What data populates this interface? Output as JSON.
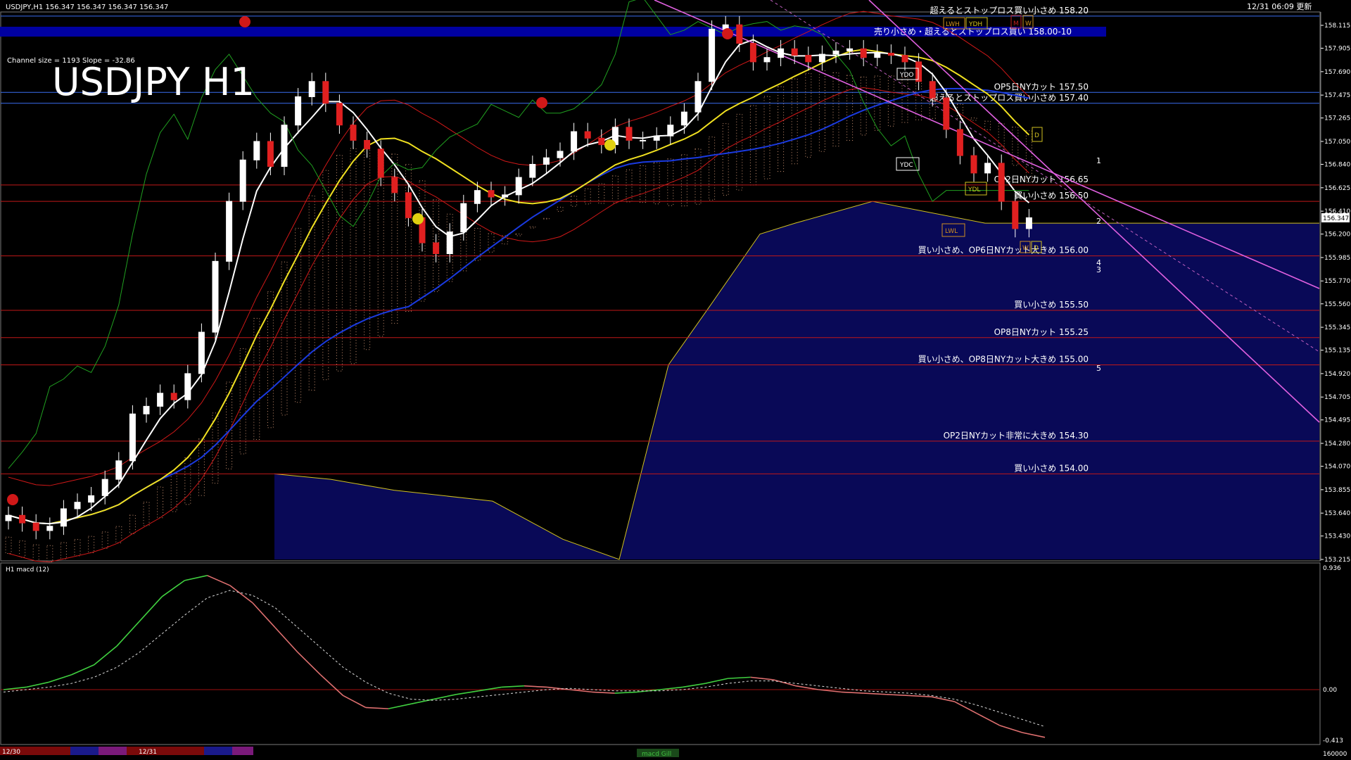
{
  "window": {
    "header": "USDJPY,H1  156.347 156.347 156.347 156.347",
    "updated": "12/31 06:09 更新",
    "big_title": "USDJPY H1",
    "channel_info": "Channel size = 1193 Slope = -32.86"
  },
  "chart_data": {
    "type": "candlestick",
    "price_range": [
      153.215,
      158.2
    ],
    "price_ticks": [
      "158.115",
      "157.905",
      "157.690",
      "157.475",
      "157.265",
      "157.050",
      "156.840",
      "156.625",
      "156.410",
      "156.200",
      "155.985",
      "155.770",
      "155.560",
      "155.345",
      "155.135",
      "154.920",
      "154.705",
      "154.495",
      "154.280",
      "154.070",
      "153.855",
      "153.640",
      "153.430",
      "153.215"
    ],
    "current_price": "156.347",
    "levels": [
      {
        "price": 158.2,
        "label": "超えるとストップロス買い小さめ 158.20",
        "color": "#3a6df0"
      },
      {
        "price": 157.5,
        "label": "OP5日NYカット 157.50",
        "color": "#3a6df0"
      },
      {
        "price": 157.4,
        "label": "超えるとストップロス買い小さめ 157.40",
        "color": "#3a6df0"
      },
      {
        "price": 156.65,
        "label": "OP2日NYカット 156.65",
        "color": "#c01818"
      },
      {
        "price": 156.5,
        "label": "買い小さめ 156.50",
        "color": "#c01818"
      },
      {
        "price": 156.0,
        "label": "買い小さめ、OP6日NYカット大きめ 156.00",
        "color": "#c01818"
      },
      {
        "price": 155.5,
        "label": "買い小さめ 155.50",
        "color": "#c01818"
      },
      {
        "price": 155.25,
        "label": "OP8日NYカット 155.25",
        "color": "#c01818"
      },
      {
        "price": 155.0,
        "label": "買い小さめ、OP8日NYカット大きめ 155.00",
        "color": "#c01818"
      },
      {
        "price": 154.3,
        "label": "OP2日NYカット非常に大きめ 154.30",
        "color": "#c01818"
      },
      {
        "price": 154.0,
        "label": "買い小さめ 154.00",
        "color": "#c01818"
      }
    ],
    "sell_band": {
      "label": "売り小さめ・超えるとストップロス買い 158.00-10",
      "color": "#0000a0"
    },
    "markers": [
      "LWH",
      "YDH",
      "M",
      "W",
      "YDO",
      "YDC",
      "YDL",
      "LWL",
      "W",
      "D",
      "D"
    ],
    "wave_labels": [
      "1",
      "2",
      "3",
      "4",
      "5"
    ],
    "candles_close": [
      153.62,
      153.55,
      153.48,
      153.52,
      153.68,
      153.74,
      153.8,
      153.95,
      154.12,
      154.55,
      154.62,
      154.74,
      154.68,
      154.92,
      155.3,
      155.95,
      156.5,
      156.88,
      157.05,
      156.82,
      157.2,
      157.46,
      157.6,
      157.4,
      157.2,
      157.06,
      156.98,
      156.72,
      156.58,
      156.35,
      156.12,
      156.02,
      156.22,
      156.48,
      156.6,
      156.54,
      156.56,
      156.72,
      156.84,
      156.9,
      156.96,
      157.14,
      157.08,
      157.02,
      157.18,
      157.06,
      157.06,
      157.1,
      157.2,
      157.32,
      157.6,
      158.08,
      158.12,
      157.95,
      157.78,
      157.82,
      157.9,
      157.84,
      157.78,
      157.85,
      157.88,
      157.9,
      157.82,
      157.86,
      157.84,
      157.78,
      157.6,
      157.45,
      157.16,
      156.92,
      156.76,
      156.85,
      156.5,
      156.25,
      156.35
    ]
  },
  "macd_panel": {
    "label": "H1  macd (12)",
    "ticks": [
      "0.936",
      "0.00",
      "-0.413"
    ],
    "macd_values": [
      0.0,
      0.02,
      0.06,
      0.12,
      0.2,
      0.35,
      0.55,
      0.75,
      0.88,
      0.92,
      0.84,
      0.7,
      0.5,
      0.3,
      0.12,
      -0.05,
      -0.15,
      -0.16,
      -0.12,
      -0.08,
      -0.04,
      -0.01,
      0.02,
      0.03,
      0.02,
      0.0,
      -0.02,
      -0.03,
      -0.02,
      0.0,
      0.02,
      0.05,
      0.09,
      0.1,
      0.08,
      0.03,
      0.0,
      -0.02,
      -0.03,
      -0.04,
      -0.05,
      -0.06,
      -0.1,
      -0.2,
      -0.3,
      -0.36,
      -0.4
    ],
    "signal_values": [
      -0.02,
      0.0,
      0.02,
      0.05,
      0.1,
      0.18,
      0.3,
      0.45,
      0.6,
      0.74,
      0.8,
      0.76,
      0.66,
      0.5,
      0.34,
      0.18,
      0.06,
      -0.03,
      -0.08,
      -0.09,
      -0.08,
      -0.06,
      -0.04,
      -0.02,
      0.0,
      0.01,
      0.0,
      -0.01,
      -0.01,
      -0.01,
      0.0,
      0.02,
      0.05,
      0.07,
      0.07,
      0.05,
      0.03,
      0.01,
      -0.01,
      -0.02,
      -0.03,
      -0.05,
      -0.08,
      -0.13,
      -0.19,
      -0.25,
      -0.31
    ]
  },
  "bottom_bar": {
    "date1": "12/30",
    "date2": "12/31",
    "macd_label": "macd Gill",
    "right": "160000"
  }
}
